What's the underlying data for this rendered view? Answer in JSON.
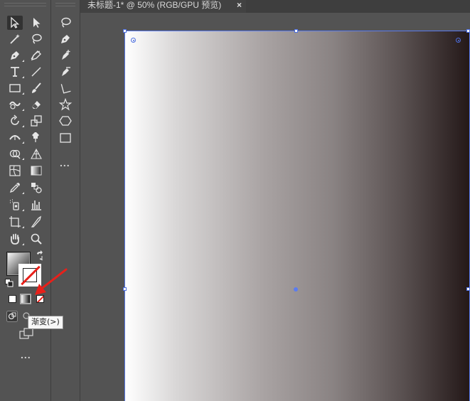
{
  "document": {
    "tab_title": "未标题-1* @ 50% (RGB/GPU 预览)",
    "close_glyph": "×"
  },
  "toolbar": {
    "more_label": "...",
    "tools_col1": [
      "selection-tool",
      "magic-wand-tool",
      "pen-tool",
      "type-tool",
      "rectangle-tool",
      "shaper-tool",
      "rotate-tool",
      "width-tool",
      "free-transform-tool",
      "mesh-tool",
      "eyedropper-tool",
      "symbol-sprayer-tool",
      "artboard-tool",
      "hand-tool"
    ],
    "tools_col2": [
      "direct-selection-tool",
      "lasso-tool",
      "curvature-tool",
      "line-segment-tool",
      "paintbrush-tool",
      "eraser-tool",
      "scale-tool",
      "puppet-warp-tool",
      "perspective-grid-tool",
      "gradient-tool",
      "blend-tool",
      "column-graph-tool",
      "slice-tool",
      "zoom-tool"
    ],
    "secondary_tools": [
      "lasso-tool",
      "pen-tool",
      "add-anchor-point-tool",
      "anchor-point-tool",
      "line-tool",
      "star-tool",
      "polygon-tool",
      "rectangle-tool"
    ]
  },
  "colors": {
    "fill_mode": "gradient",
    "stroke": "none",
    "accent_selection": "#5b7cf0",
    "arrow": "#e8201a",
    "gradient_start": "#ffffff",
    "gradient_end": "#231816"
  },
  "tooltip": {
    "text": "渐变(>)"
  }
}
